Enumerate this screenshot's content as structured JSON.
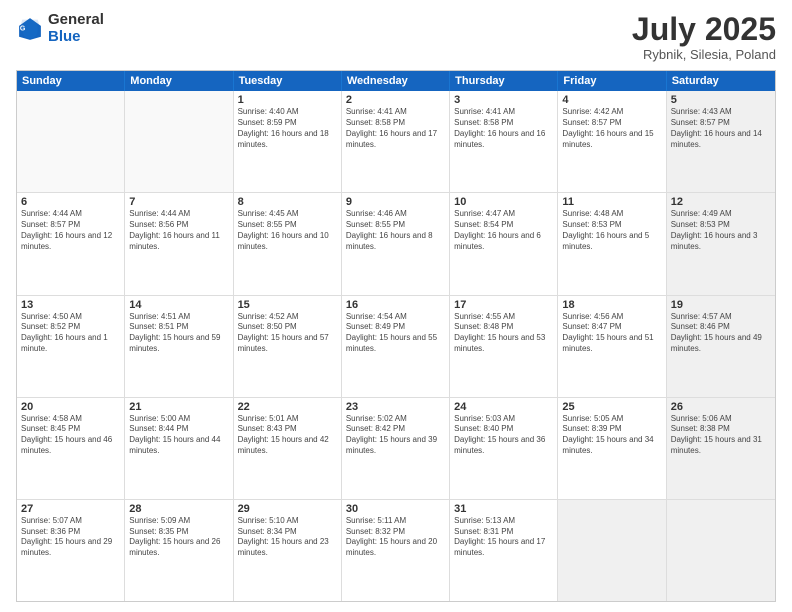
{
  "header": {
    "logo_general": "General",
    "logo_blue": "Blue",
    "month": "July 2025",
    "location": "Rybnik, Silesia, Poland"
  },
  "weekdays": [
    "Sunday",
    "Monday",
    "Tuesday",
    "Wednesday",
    "Thursday",
    "Friday",
    "Saturday"
  ],
  "rows": [
    [
      {
        "day": "",
        "text": "",
        "shaded": false,
        "empty": true
      },
      {
        "day": "",
        "text": "",
        "shaded": false,
        "empty": true
      },
      {
        "day": "1",
        "text": "Sunrise: 4:40 AM\nSunset: 8:59 PM\nDaylight: 16 hours and 18 minutes.",
        "shaded": false,
        "empty": false
      },
      {
        "day": "2",
        "text": "Sunrise: 4:41 AM\nSunset: 8:58 PM\nDaylight: 16 hours and 17 minutes.",
        "shaded": false,
        "empty": false
      },
      {
        "day": "3",
        "text": "Sunrise: 4:41 AM\nSunset: 8:58 PM\nDaylight: 16 hours and 16 minutes.",
        "shaded": false,
        "empty": false
      },
      {
        "day": "4",
        "text": "Sunrise: 4:42 AM\nSunset: 8:57 PM\nDaylight: 16 hours and 15 minutes.",
        "shaded": false,
        "empty": false
      },
      {
        "day": "5",
        "text": "Sunrise: 4:43 AM\nSunset: 8:57 PM\nDaylight: 16 hours and 14 minutes.",
        "shaded": true,
        "empty": false
      }
    ],
    [
      {
        "day": "6",
        "text": "Sunrise: 4:44 AM\nSunset: 8:57 PM\nDaylight: 16 hours and 12 minutes.",
        "shaded": false,
        "empty": false
      },
      {
        "day": "7",
        "text": "Sunrise: 4:44 AM\nSunset: 8:56 PM\nDaylight: 16 hours and 11 minutes.",
        "shaded": false,
        "empty": false
      },
      {
        "day": "8",
        "text": "Sunrise: 4:45 AM\nSunset: 8:55 PM\nDaylight: 16 hours and 10 minutes.",
        "shaded": false,
        "empty": false
      },
      {
        "day": "9",
        "text": "Sunrise: 4:46 AM\nSunset: 8:55 PM\nDaylight: 16 hours and 8 minutes.",
        "shaded": false,
        "empty": false
      },
      {
        "day": "10",
        "text": "Sunrise: 4:47 AM\nSunset: 8:54 PM\nDaylight: 16 hours and 6 minutes.",
        "shaded": false,
        "empty": false
      },
      {
        "day": "11",
        "text": "Sunrise: 4:48 AM\nSunset: 8:53 PM\nDaylight: 16 hours and 5 minutes.",
        "shaded": false,
        "empty": false
      },
      {
        "day": "12",
        "text": "Sunrise: 4:49 AM\nSunset: 8:53 PM\nDaylight: 16 hours and 3 minutes.",
        "shaded": true,
        "empty": false
      }
    ],
    [
      {
        "day": "13",
        "text": "Sunrise: 4:50 AM\nSunset: 8:52 PM\nDaylight: 16 hours and 1 minute.",
        "shaded": false,
        "empty": false
      },
      {
        "day": "14",
        "text": "Sunrise: 4:51 AM\nSunset: 8:51 PM\nDaylight: 15 hours and 59 minutes.",
        "shaded": false,
        "empty": false
      },
      {
        "day": "15",
        "text": "Sunrise: 4:52 AM\nSunset: 8:50 PM\nDaylight: 15 hours and 57 minutes.",
        "shaded": false,
        "empty": false
      },
      {
        "day": "16",
        "text": "Sunrise: 4:54 AM\nSunset: 8:49 PM\nDaylight: 15 hours and 55 minutes.",
        "shaded": false,
        "empty": false
      },
      {
        "day": "17",
        "text": "Sunrise: 4:55 AM\nSunset: 8:48 PM\nDaylight: 15 hours and 53 minutes.",
        "shaded": false,
        "empty": false
      },
      {
        "day": "18",
        "text": "Sunrise: 4:56 AM\nSunset: 8:47 PM\nDaylight: 15 hours and 51 minutes.",
        "shaded": false,
        "empty": false
      },
      {
        "day": "19",
        "text": "Sunrise: 4:57 AM\nSunset: 8:46 PM\nDaylight: 15 hours and 49 minutes.",
        "shaded": true,
        "empty": false
      }
    ],
    [
      {
        "day": "20",
        "text": "Sunrise: 4:58 AM\nSunset: 8:45 PM\nDaylight: 15 hours and 46 minutes.",
        "shaded": false,
        "empty": false
      },
      {
        "day": "21",
        "text": "Sunrise: 5:00 AM\nSunset: 8:44 PM\nDaylight: 15 hours and 44 minutes.",
        "shaded": false,
        "empty": false
      },
      {
        "day": "22",
        "text": "Sunrise: 5:01 AM\nSunset: 8:43 PM\nDaylight: 15 hours and 42 minutes.",
        "shaded": false,
        "empty": false
      },
      {
        "day": "23",
        "text": "Sunrise: 5:02 AM\nSunset: 8:42 PM\nDaylight: 15 hours and 39 minutes.",
        "shaded": false,
        "empty": false
      },
      {
        "day": "24",
        "text": "Sunrise: 5:03 AM\nSunset: 8:40 PM\nDaylight: 15 hours and 36 minutes.",
        "shaded": false,
        "empty": false
      },
      {
        "day": "25",
        "text": "Sunrise: 5:05 AM\nSunset: 8:39 PM\nDaylight: 15 hours and 34 minutes.",
        "shaded": false,
        "empty": false
      },
      {
        "day": "26",
        "text": "Sunrise: 5:06 AM\nSunset: 8:38 PM\nDaylight: 15 hours and 31 minutes.",
        "shaded": true,
        "empty": false
      }
    ],
    [
      {
        "day": "27",
        "text": "Sunrise: 5:07 AM\nSunset: 8:36 PM\nDaylight: 15 hours and 29 minutes.",
        "shaded": false,
        "empty": false
      },
      {
        "day": "28",
        "text": "Sunrise: 5:09 AM\nSunset: 8:35 PM\nDaylight: 15 hours and 26 minutes.",
        "shaded": false,
        "empty": false
      },
      {
        "day": "29",
        "text": "Sunrise: 5:10 AM\nSunset: 8:34 PM\nDaylight: 15 hours and 23 minutes.",
        "shaded": false,
        "empty": false
      },
      {
        "day": "30",
        "text": "Sunrise: 5:11 AM\nSunset: 8:32 PM\nDaylight: 15 hours and 20 minutes.",
        "shaded": false,
        "empty": false
      },
      {
        "day": "31",
        "text": "Sunrise: 5:13 AM\nSunset: 8:31 PM\nDaylight: 15 hours and 17 minutes.",
        "shaded": false,
        "empty": false
      },
      {
        "day": "",
        "text": "",
        "shaded": true,
        "empty": true
      },
      {
        "day": "",
        "text": "",
        "shaded": true,
        "empty": true
      }
    ]
  ]
}
